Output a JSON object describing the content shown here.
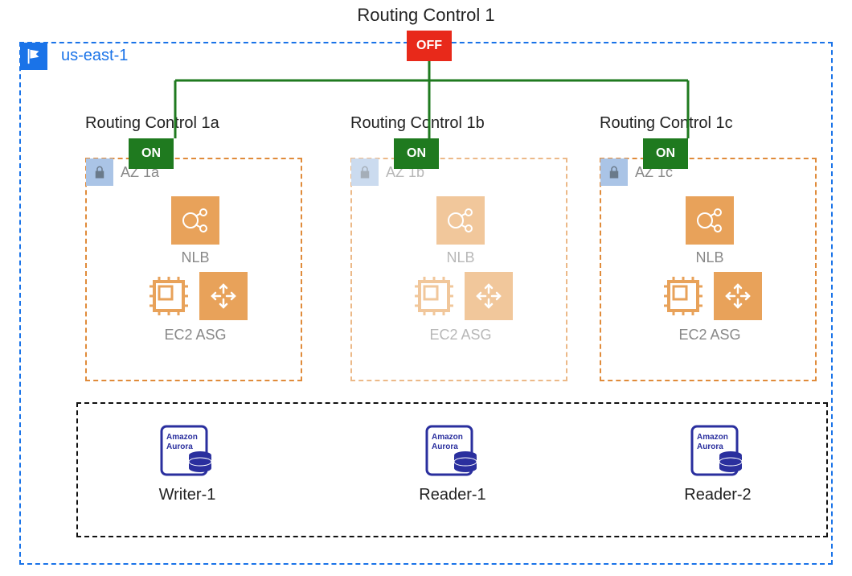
{
  "title": "Routing Control 1",
  "top_state": "OFF",
  "region": {
    "name": "us-east-1"
  },
  "controls": [
    {
      "title": "Routing Control 1a",
      "state": "ON",
      "az": "AZ 1a",
      "nlb": "NLB",
      "compute": "EC2 ASG",
      "faded": false
    },
    {
      "title": "Routing Control 1b",
      "state": "ON",
      "az": "AZ 1b",
      "nlb": "NLB",
      "compute": "EC2 ASG",
      "faded": true
    },
    {
      "title": "Routing Control 1c",
      "state": "ON",
      "az": "AZ 1c",
      "nlb": "NLB",
      "compute": "EC2 ASG",
      "faded": false
    }
  ],
  "databases": [
    {
      "service": "Amazon Aurora",
      "role": "Writer-1"
    },
    {
      "service": "Amazon Aurora",
      "role": "Reader-1"
    },
    {
      "service": "Amazon Aurora",
      "role": "Reader-2"
    }
  ],
  "colors": {
    "off": "#e8291a",
    "on": "#1f7a1f",
    "region_border": "#1a73e8",
    "az_border": "#e08b3a",
    "aurora": "#2a2f9e"
  },
  "chart_data": {
    "type": "diagram",
    "description": "AWS us-east-1 region with top-level Routing Control 1 (OFF) branching to three zone-level routing controls 1a/1b/1c (all ON). Each zone has an NLB and an EC2 Auto Scaling Group. A shared Aurora cluster has one writer and two readers."
  }
}
